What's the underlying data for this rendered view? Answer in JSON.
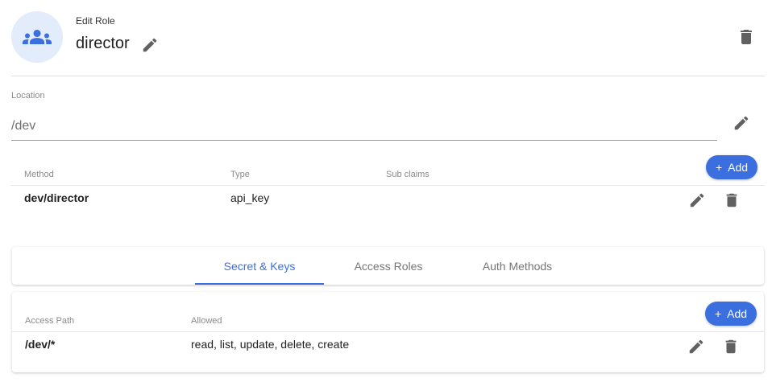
{
  "header": {
    "subtitle": "Edit Role",
    "role_name": "director",
    "avatar_icon": "group-icon",
    "accent": "#3b6fe0"
  },
  "location": {
    "label": "Location",
    "value": "/dev"
  },
  "auth_table": {
    "columns": [
      "Method",
      "Type",
      "Sub claims"
    ],
    "add_label": "Add",
    "rows": [
      {
        "method": "dev/director",
        "type": "api_key",
        "sub_claims": ""
      }
    ]
  },
  "tabs": [
    {
      "label": "Secret & Keys",
      "active": true
    },
    {
      "label": "Access Roles",
      "active": false
    },
    {
      "label": "Auth Methods",
      "active": false
    }
  ],
  "access_table": {
    "columns": [
      "Access Path",
      "Allowed"
    ],
    "add_label": "Add",
    "rows": [
      {
        "path": "/dev/*",
        "allowed": "read, list, update, delete, create"
      }
    ]
  }
}
